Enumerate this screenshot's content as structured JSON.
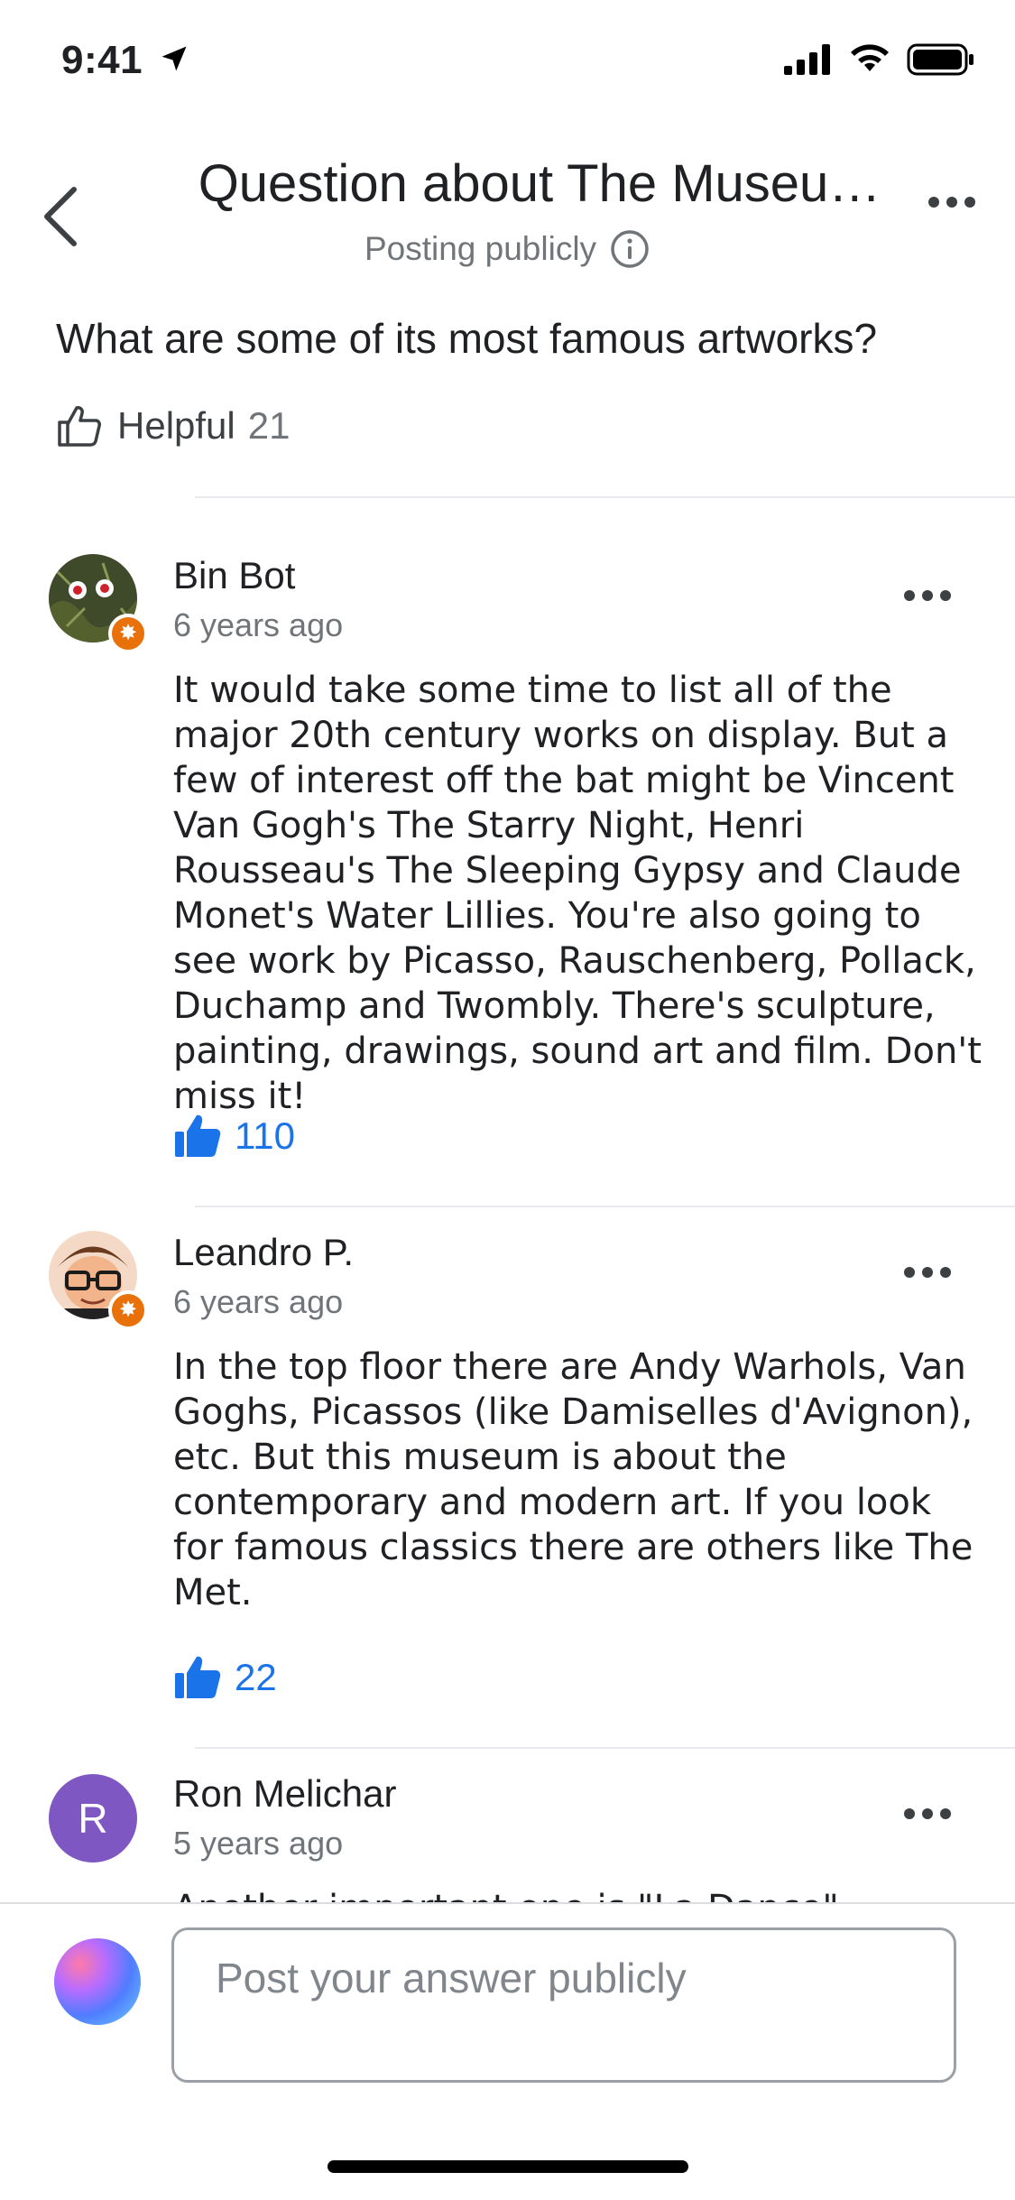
{
  "status_bar": {
    "time": "9:41"
  },
  "header": {
    "title": "Question about The Museu…",
    "subtitle": "Posting publicly"
  },
  "question": {
    "text": "What are some of its most famous artworks?",
    "helpful_label": "Helpful",
    "helpful_count": "21"
  },
  "answers": [
    {
      "author": "Bin Bot",
      "time": "6 years ago",
      "body": "It would take some time to list all of the major 20th century works on display. But a few of interest off the bat might be Vincent Van Gogh's The Starry Night,  Henri Rousseau's The Sleeping Gypsy and Claude Monet's Water Lillies. You're also going to see work by Picasso, Rauschenberg, Pollack, Duchamp and Twombly. There's sculpture, painting, drawings, sound art and film. Don't miss it!",
      "likes": "110"
    },
    {
      "author": "Leandro P.",
      "time": "6 years ago",
      "body": "In the top floor there are Andy Warhols, Van Goghs, Picassos (like Damiselles d'Avignon), etc. But this museum is about the contemporary and modern art. If you look for famous classics there are others like The Met.",
      "likes": "22"
    },
    {
      "author": "Ron Melichar",
      "avatar_letter": "R",
      "time": "5 years ago",
      "body": "Another important one is \"La Dance\""
    }
  ],
  "compose": {
    "placeholder": "Post your answer publicly"
  },
  "colors": {
    "accent": "#1a73e8",
    "badge": "#e8710a",
    "avatar_purple": "#7e57c2"
  }
}
